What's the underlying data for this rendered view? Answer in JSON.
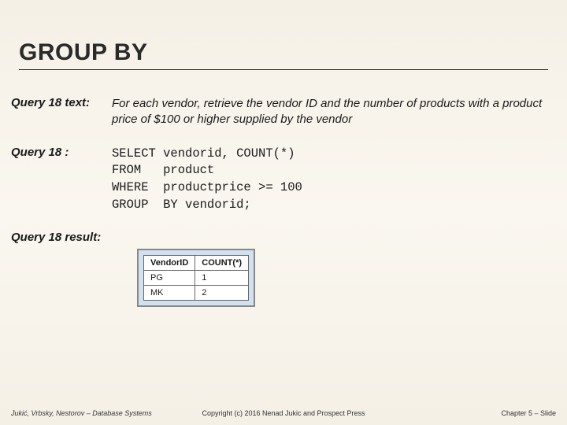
{
  "title": "GROUP BY",
  "query_text": {
    "label": "Query 18 text:",
    "body": "For each vendor, retrieve the vendor ID and the number of products with a product price of $100 or higher supplied by the vendor"
  },
  "query_sql": {
    "label": "Query 18 :",
    "lines": [
      "SELECT vendorid, COUNT(*)",
      "FROM   product",
      "WHERE  productprice >= 100",
      "GROUP  BY vendorid;"
    ]
  },
  "query_result": {
    "label": "Query 18 result:",
    "headers": [
      "VendorID",
      "COUNT(*)"
    ],
    "rows": [
      [
        "PG",
        "1"
      ],
      [
        "MK",
        "2"
      ]
    ]
  },
  "footer": {
    "left": "Jukić, Vrbsky, Nestorov – Database Systems",
    "center": "Copyright (c) 2016 Nenad Jukic and Prospect Press",
    "right": "Chapter 5 – Slide"
  }
}
